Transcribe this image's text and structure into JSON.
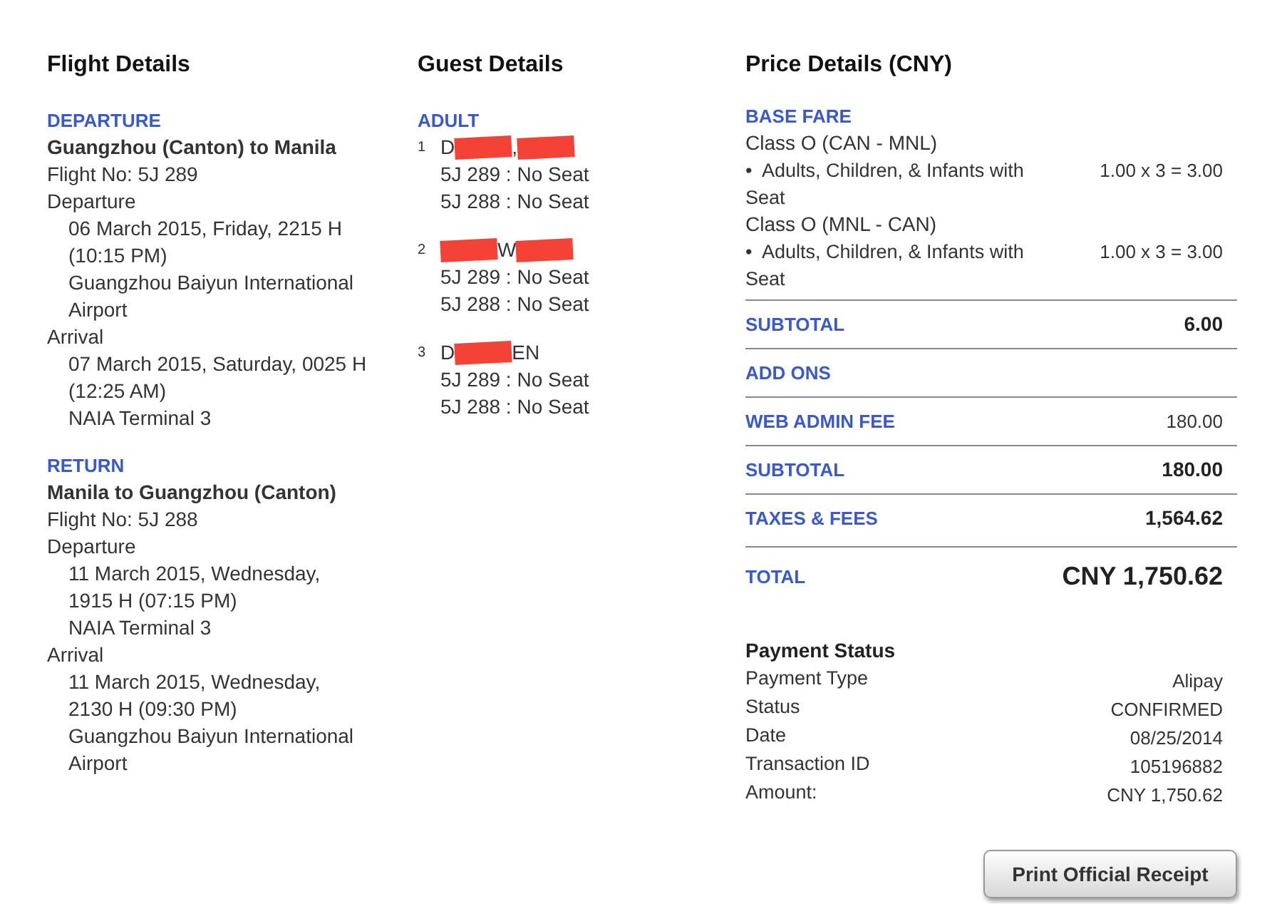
{
  "flight_details": {
    "title": "Flight Details",
    "segments": [
      {
        "label": "DEPARTURE",
        "route": "Guangzhou (Canton) to Manila",
        "flight_no": "Flight No: 5J 289",
        "departure_label": "Departure",
        "departure_lines": [
          "06 March 2015, Friday, 2215 H",
          "(10:15 PM)",
          "Guangzhou Baiyun International",
          "Airport"
        ],
        "arrival_label": "Arrival",
        "arrival_lines": [
          "07 March 2015, Saturday, 0025 H",
          "(12:25 AM)",
          "NAIA Terminal 3"
        ]
      },
      {
        "label": "RETURN",
        "route": "Manila to Guangzhou (Canton)",
        "flight_no": "Flight No: 5J 288",
        "departure_label": "Departure",
        "departure_lines": [
          "11 March 2015, Wednesday,",
          "1915 H (07:15 PM)",
          "NAIA Terminal 3"
        ],
        "arrival_label": "Arrival",
        "arrival_lines": [
          "11 March 2015, Wednesday,",
          "2130 H (09:30 PM)",
          "Guangzhou Baiyun International",
          "Airport"
        ]
      }
    ]
  },
  "guest_details": {
    "title": "Guest Details",
    "group_label": "ADULT",
    "guests": [
      {
        "number": "1",
        "name_parts": [
          {
            "kind": "text",
            "text": "D"
          },
          {
            "kind": "redaction"
          },
          {
            "kind": "text",
            "text": ","
          },
          {
            "kind": "redaction"
          }
        ],
        "seats": [
          "5J 289 : No Seat",
          "5J 288 : No Seat"
        ]
      },
      {
        "number": "2",
        "name_parts": [
          {
            "kind": "redaction"
          },
          {
            "kind": "text",
            "text": "W"
          },
          {
            "kind": "redaction"
          }
        ],
        "seats": [
          "5J 289 : No Seat",
          "5J 288 : No Seat"
        ]
      },
      {
        "number": "3",
        "name_parts": [
          {
            "kind": "text",
            "text": "D"
          },
          {
            "kind": "redaction"
          },
          {
            "kind": "text",
            "text": "EN"
          }
        ],
        "seats": [
          "5J 289 : No Seat",
          "5J 288 : No Seat"
        ]
      }
    ]
  },
  "price_details": {
    "title": "Price Details (CNY)",
    "base_fare": {
      "label": "BASE FARE",
      "classes": [
        {
          "name": "Class O (CAN - MNL)",
          "item": "•  Adults, Children, & Infants with Seat",
          "amount": "1.00 x 3 = 3.00"
        },
        {
          "name": "Class O (MNL - CAN)",
          "item": "•  Adults, Children, & Infants with Seat",
          "amount": "1.00 x 3 = 3.00"
        }
      ]
    },
    "rows": [
      {
        "label": "SUBTOTAL",
        "value": "6.00",
        "kind": "bold"
      },
      {
        "label": "ADD ONS",
        "kind": "plain"
      },
      {
        "label": "WEB ADMIN FEE",
        "value": "180.00",
        "kind": "plain"
      },
      {
        "label": "SUBTOTAL",
        "value": "180.00",
        "kind": "bold"
      },
      {
        "label": "TAXES & FEES",
        "value": "1,564.62",
        "kind": "bold"
      },
      {
        "label": "TOTAL",
        "value": "CNY 1,750.62",
        "kind": "total"
      }
    ]
  },
  "payment_status": {
    "title": "Payment Status",
    "rows": [
      {
        "label": "Payment Type",
        "value": "Alipay"
      },
      {
        "label": "Status",
        "value": "CONFIRMED"
      },
      {
        "label": "Date",
        "value": "08/25/2014"
      },
      {
        "label": "Transaction ID",
        "value": "105196882"
      },
      {
        "label": "Amount:",
        "value": "CNY 1,750.62"
      }
    ]
  },
  "print_button": "Print Official Receipt"
}
